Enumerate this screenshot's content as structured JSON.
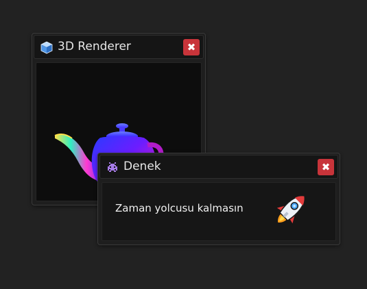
{
  "windows": {
    "renderer": {
      "title": "3D Renderer",
      "close_glyph": "✖",
      "icon": "cube-icon",
      "viewport_content": "teapot-render"
    },
    "denek": {
      "title": "Denek",
      "close_glyph": "✖",
      "icon": "space-invader-icon",
      "message": "Zaman yolcusu kalmasın",
      "illustration": "rocket-icon"
    }
  },
  "colors": {
    "background": "#222222",
    "close_button": "#c8343a",
    "title_text": "#e6e6e6"
  }
}
